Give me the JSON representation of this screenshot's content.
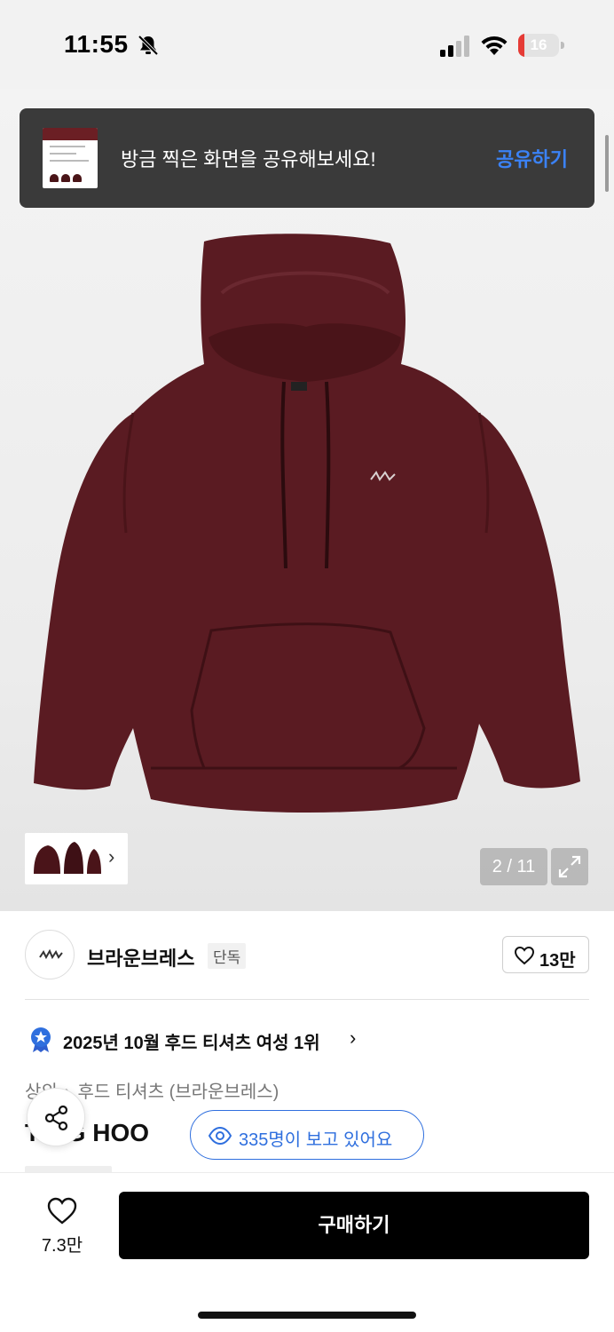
{
  "status_bar": {
    "time": "11:55",
    "battery_level": "16",
    "battery_fraction": 0.16,
    "icons": [
      "bell-slash-icon",
      "cellular-signal-icon",
      "wifi-icon",
      "battery-icon"
    ]
  },
  "share_toast": {
    "message": "방금 찍은 화면을 공유해보세요!",
    "action_label": "공유하기"
  },
  "gallery": {
    "current": "2",
    "total": "11",
    "counter_label": "2 / 11",
    "thumb_more_icon": "chevron-right-icon"
  },
  "brand": {
    "name": "브라운브레스",
    "exclusive_badge": "단독",
    "like_count": "13만"
  },
  "ranking": {
    "text": "2025년 10월 후드 티셔츠 여성 1위"
  },
  "breadcrumb": {
    "items": [
      "상의",
      "후드 티셔츠 (브라운브레스)"
    ],
    "separator": "›"
  },
  "product": {
    "title_visible": "T  OG HOO"
  },
  "viewers": {
    "text": "335명이 보고 있어요"
  },
  "bottom_bar": {
    "wishlist_count": "7.3만",
    "buy_label": "구매하기"
  },
  "colors": {
    "hoodie": "#5a1b22",
    "accent_blue": "#2f6fde",
    "toast_bg": "#3a3a3a",
    "buy_bg": "#000000"
  }
}
